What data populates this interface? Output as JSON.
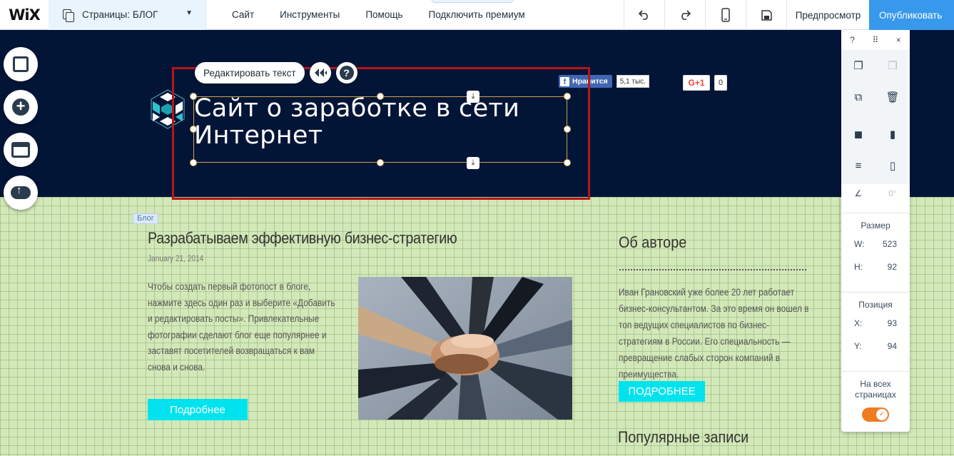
{
  "topbar": {
    "logo": "WiX",
    "pages_label": "Страницы: БЛОГ",
    "menu": [
      "Сайт",
      "Инструменты",
      "Помощь",
      "Подключить премиум"
    ],
    "preview": "Предпросмотр",
    "publish": "Опубликовать"
  },
  "edit_toolbar": {
    "edit_text": "Редактировать текст",
    "help": "?"
  },
  "site": {
    "title_line1": "Сайт о заработке в сети",
    "title_line2": "Интернет"
  },
  "social": {
    "fb_like": "Нравится",
    "fb_count": "5,1 тыс.",
    "gplus": "G+1",
    "gplus_count": "0"
  },
  "post": {
    "tag": "Блог",
    "title": "Разрабатываем эффективную бизнес-стратегию",
    "date": "January 21, 2014",
    "text": "Чтобы создать первый фотопост в блоге, нажмите здесь один раз и выберите «Добавить и редактировать посты». Привлекательные фотографии сделают блог еще популярнее и заставят посетителей возвращаться к вам снова и снова.",
    "button": "Подробнее"
  },
  "about": {
    "title": "Об авторе",
    "text": "Иван Грановский уже более 20 лет работает бизнес-консультантом. За это время он вошел в топ ведущих специалистов по бизнес-стратегиям в России. Его специальность — превращение слабых сторон компаний в преимущества.",
    "button": "ПОДРОБНЕЕ",
    "popular": "Популярные записи"
  },
  "panel": {
    "help": "?",
    "close": "×",
    "rotation": "0°",
    "size_label": "Размер",
    "w_label": "W:",
    "w": "523",
    "h_label": "H:",
    "h": "92",
    "pos_label": "Позиция",
    "x_label": "X:",
    "x": "93",
    "y_label": "Y:",
    "y": "94",
    "all_pages": "На всех страницах",
    "all_pages_on": true
  },
  "colors": {
    "accent": "#3899ec",
    "header_bg": "#031537",
    "cyan_button": "#00e3ee",
    "toggle": "#f07b22",
    "selection": "#b8141a"
  }
}
